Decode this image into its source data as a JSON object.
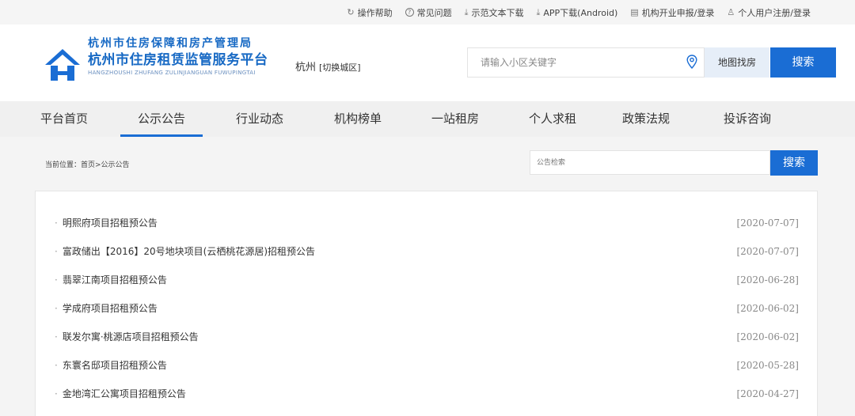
{
  "topbar": {
    "links": [
      {
        "icon": "refresh-icon",
        "glyph": "↻",
        "label": "操作帮助"
      },
      {
        "icon": "question-icon",
        "glyph": "?",
        "label": "常见问题"
      },
      {
        "icon": "download-icon",
        "glyph": "⤓",
        "label": "示范文本下载"
      },
      {
        "icon": "download-icon",
        "glyph": "⤓",
        "label": "APP下载(Android)"
      },
      {
        "icon": "building-icon",
        "glyph": "▤",
        "label": "机构开业申报/登录"
      },
      {
        "icon": "user-icon",
        "glyph": "♙",
        "label": "个人用户注册/登录"
      }
    ]
  },
  "header": {
    "brand_line1": "杭州市住房保障和房产管理局",
    "brand_line2": "杭州市住房租赁监管服务平台",
    "brand_line3": "HANGZHOUSHI ZHUFANG ZULINJIANGUAN FUWUPINGTAI",
    "city": "杭州",
    "city_switch": "[切换城区]",
    "search_placeholder": "请输入小区关键字",
    "map_label": "地图找房",
    "search_label": "搜索",
    "brand_color": "#1769c4",
    "accent": "#1a6dd4"
  },
  "nav": {
    "items": [
      "平台首页",
      "公示公告",
      "行业动态",
      "机构榜单",
      "一站租房",
      "个人求租",
      "政策法规",
      "投诉咨询"
    ],
    "active_index": 1
  },
  "main": {
    "breadcrumb": "当前位置：首页>公示公告",
    "notice_search_placeholder": "公告检索",
    "notice_search_label": "搜索",
    "notices": [
      {
        "title": "明熙府项目招租预公告",
        "date": "[2020-07-07]"
      },
      {
        "title": "富政储出【2016】20号地块项目(云栖桃花源居)招租预公告",
        "date": "[2020-07-07]"
      },
      {
        "title": "翡翠江南项目招租预公告",
        "date": "[2020-06-28]"
      },
      {
        "title": "学成府项目招租预公告",
        "date": "[2020-06-02]"
      },
      {
        "title": "联发尔寓·桃源店项目招租预公告",
        "date": "[2020-06-02]"
      },
      {
        "title": "东寰名邸项目招租预公告",
        "date": "[2020-05-28]"
      },
      {
        "title": "金地湾汇公寓项目招租预公告",
        "date": "[2020-04-27]"
      }
    ]
  }
}
